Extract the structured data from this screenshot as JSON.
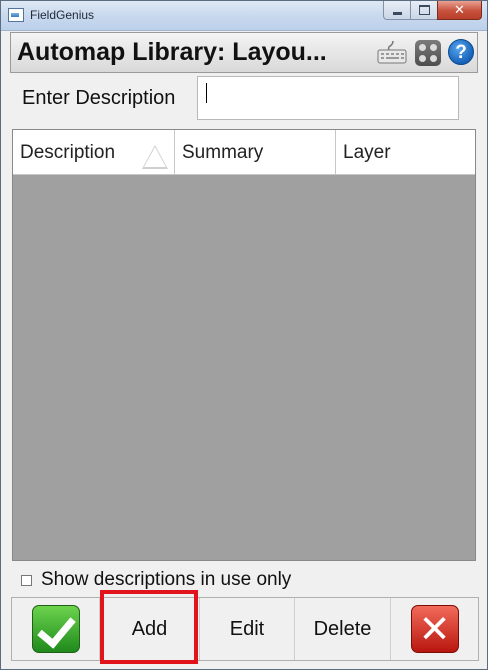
{
  "window": {
    "title": "FieldGenius"
  },
  "header": {
    "title": "Automap Library: Layou..."
  },
  "icons": {
    "keyboard": "keyboard-icon",
    "calculator": "calculator-icon",
    "help": "help-icon",
    "help_glyph": "?"
  },
  "description": {
    "label": "Enter Description",
    "value": ""
  },
  "table": {
    "columns": [
      {
        "label": "Description",
        "sorted": "ascending"
      },
      {
        "label": "Summary"
      },
      {
        "label": "Layer"
      }
    ],
    "rows": []
  },
  "filter": {
    "label": "Show descriptions in use only",
    "checked": false
  },
  "buttons": {
    "add": "Add",
    "edit": "Edit",
    "delete": "Delete"
  },
  "colors": {
    "highlight": "#e0141a",
    "table_background": "#a0a0a0"
  }
}
